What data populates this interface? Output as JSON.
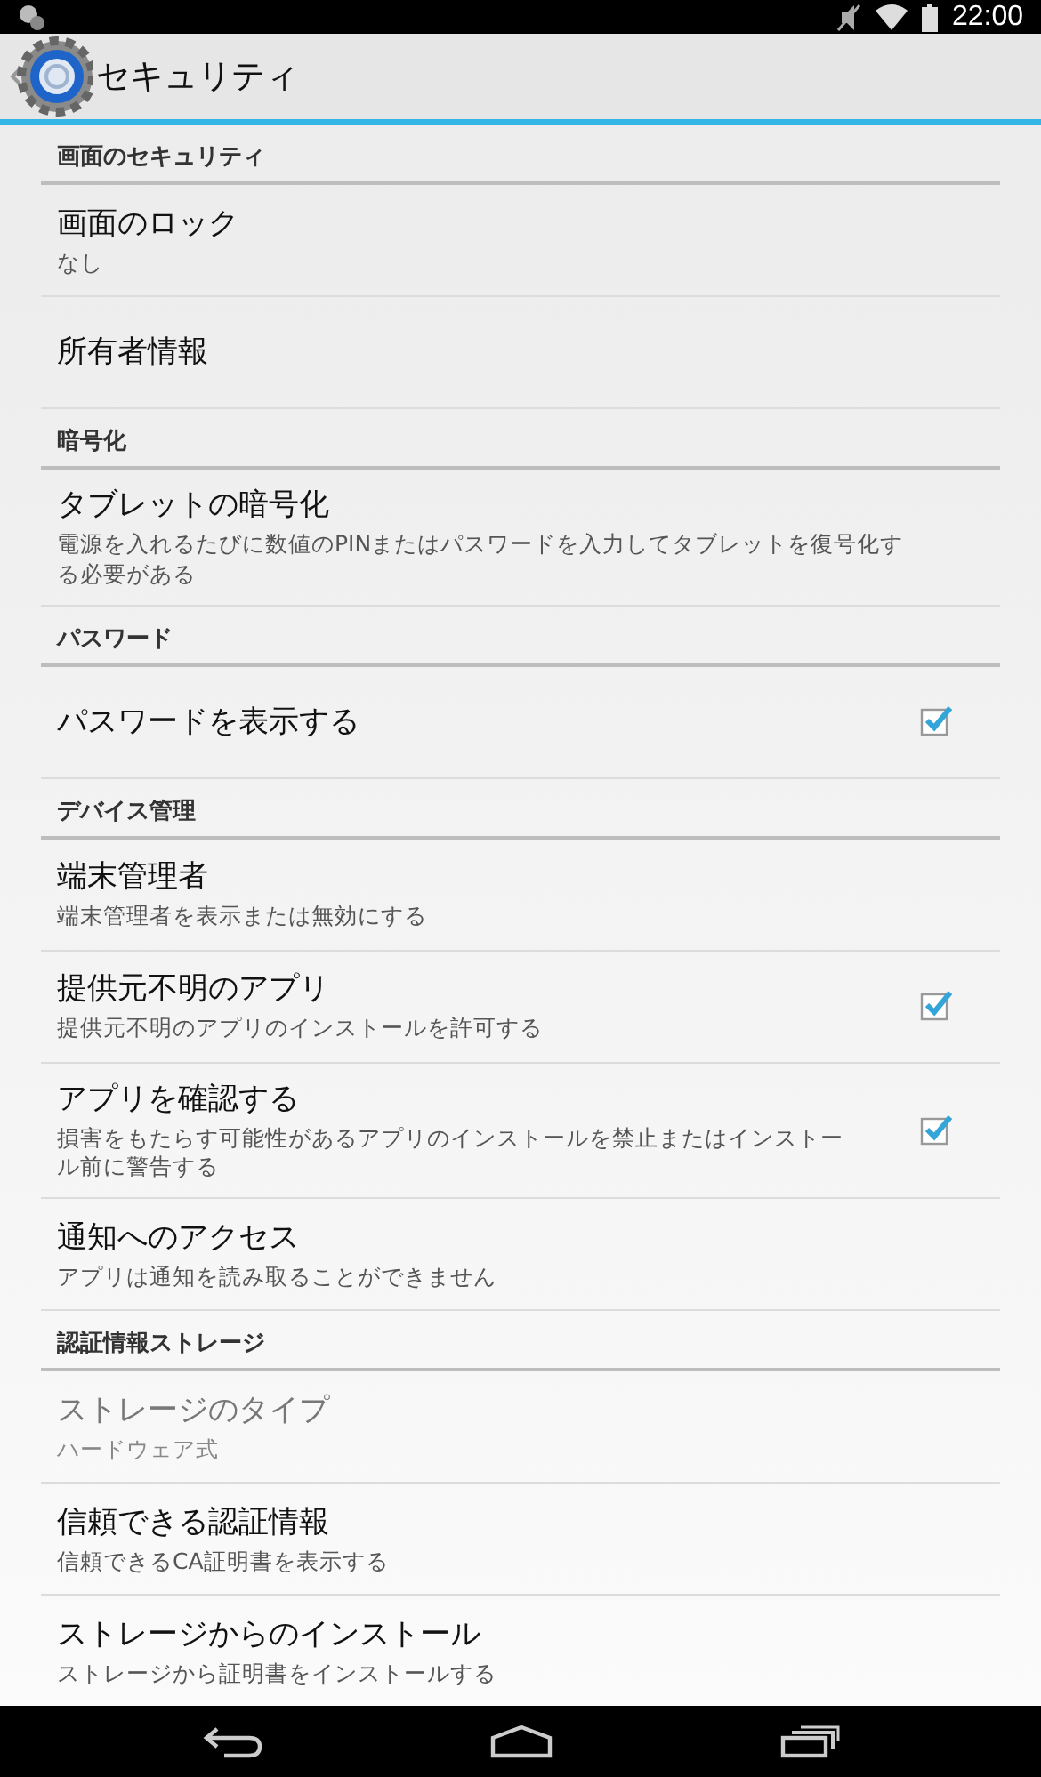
{
  "status_bar": {
    "time": "22:00"
  },
  "action_bar": {
    "title": "セキュリティ"
  },
  "sections": [
    {
      "header": "画面のセキュリティ",
      "items": [
        {
          "kind": "plain",
          "title": "画面のロック",
          "summary": "なし",
          "disabled": false
        },
        {
          "kind": "plain",
          "title": "所有者情報",
          "disabled": false
        }
      ]
    },
    {
      "header": "暗号化",
      "items": [
        {
          "kind": "plain",
          "title": "タブレットの暗号化",
          "summary": "電源を入れるたびに数値のPINまたはパスワードを入力してタブレットを復号化する必要がある",
          "disabled": false
        }
      ]
    },
    {
      "header": "パスワード",
      "items": [
        {
          "kind": "checkbox",
          "title": "パスワードを表示する",
          "checked": true,
          "disabled": false
        }
      ]
    },
    {
      "header": "デバイス管理",
      "items": [
        {
          "kind": "plain",
          "title": "端末管理者",
          "summary": "端末管理者を表示または無効にする",
          "disabled": false
        },
        {
          "kind": "checkbox",
          "title": "提供元不明のアプリ",
          "summary": "提供元不明のアプリのインストールを許可する",
          "checked": true,
          "disabled": false
        },
        {
          "kind": "checkbox",
          "title": "アプリを確認する",
          "summary": "損害をもたらす可能性があるアプリのインストールを禁止またはインストール前に警告する",
          "checked": true,
          "disabled": false
        },
        {
          "kind": "plain",
          "title": "通知へのアクセス",
          "summary": "アプリは通知を読み取ることができません",
          "disabled": false
        }
      ]
    },
    {
      "header": "認証情報ストレージ",
      "items": [
        {
          "kind": "plain",
          "title": "ストレージのタイプ",
          "summary": "ハードウェア式",
          "disabled": true
        },
        {
          "kind": "plain",
          "title": "信頼できる認証情報",
          "summary": "信頼できるCA証明書を表示する",
          "disabled": false
        },
        {
          "kind": "plain",
          "title": "ストレージからのインストール",
          "summary": "ストレージから証明書をインストールする",
          "disabled": false
        }
      ]
    }
  ]
}
